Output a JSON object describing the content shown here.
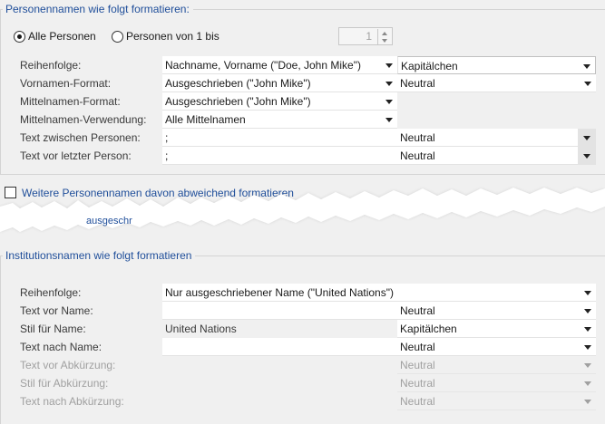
{
  "persons": {
    "group_title": "Personennamen wie folgt formatieren:",
    "radio_all": "Alle Personen",
    "radio_first": "Personen von 1 bis",
    "spin_value": "1",
    "rows": [
      {
        "label": "Reihenfolge:",
        "value": "Nachname, Vorname (\"Doe, John Mike\")",
        "value2": "Kapitälchen"
      },
      {
        "label": "Vornamen-Format:",
        "value": "Ausgeschrieben (\"John Mike\")",
        "value2": "Neutral"
      },
      {
        "label": "Mittelnamen-Format:",
        "value": "Ausgeschrieben (\"John Mike\")"
      },
      {
        "label": "Mittelnamen-Verwendung:",
        "value": "Alle Mittelnamen"
      },
      {
        "label": "Text zwischen Personen:",
        "value": ";",
        "value2": "Neutral"
      },
      {
        "label": "Text vor letzter Person:",
        "value": ";",
        "value2": "Neutral"
      }
    ]
  },
  "other_persons": {
    "checkbox_label": "Weitere Personennamen davon abweichend formatieren",
    "partial_text": "ausgeschr"
  },
  "institutions": {
    "group_title": "Institutionsnamen wie folgt formatieren",
    "rows": [
      {
        "label": "Reihenfolge:",
        "value": "Nur ausgeschriebener Name (\"United Nations\")"
      },
      {
        "label": "Text vor Name:",
        "value": "",
        "value2": "Neutral"
      },
      {
        "label": "Stil für Name:",
        "value": "United Nations",
        "value2": "Kapitälchen"
      },
      {
        "label": "Text nach Name:",
        "value": "",
        "value2": "Neutral"
      },
      {
        "label": "Text vor Abkürzung:",
        "value": "",
        "value2": "Neutral"
      },
      {
        "label": "Stil für Abkürzung:",
        "value": "",
        "value2": "Neutral"
      },
      {
        "label": "Text nach Abkürzung:",
        "value": "",
        "value2": "Neutral"
      }
    ]
  },
  "colors": {
    "group_title": "#1f4e9a",
    "disabled_text": "#a0a0a0",
    "background": "#f0f0f0"
  }
}
